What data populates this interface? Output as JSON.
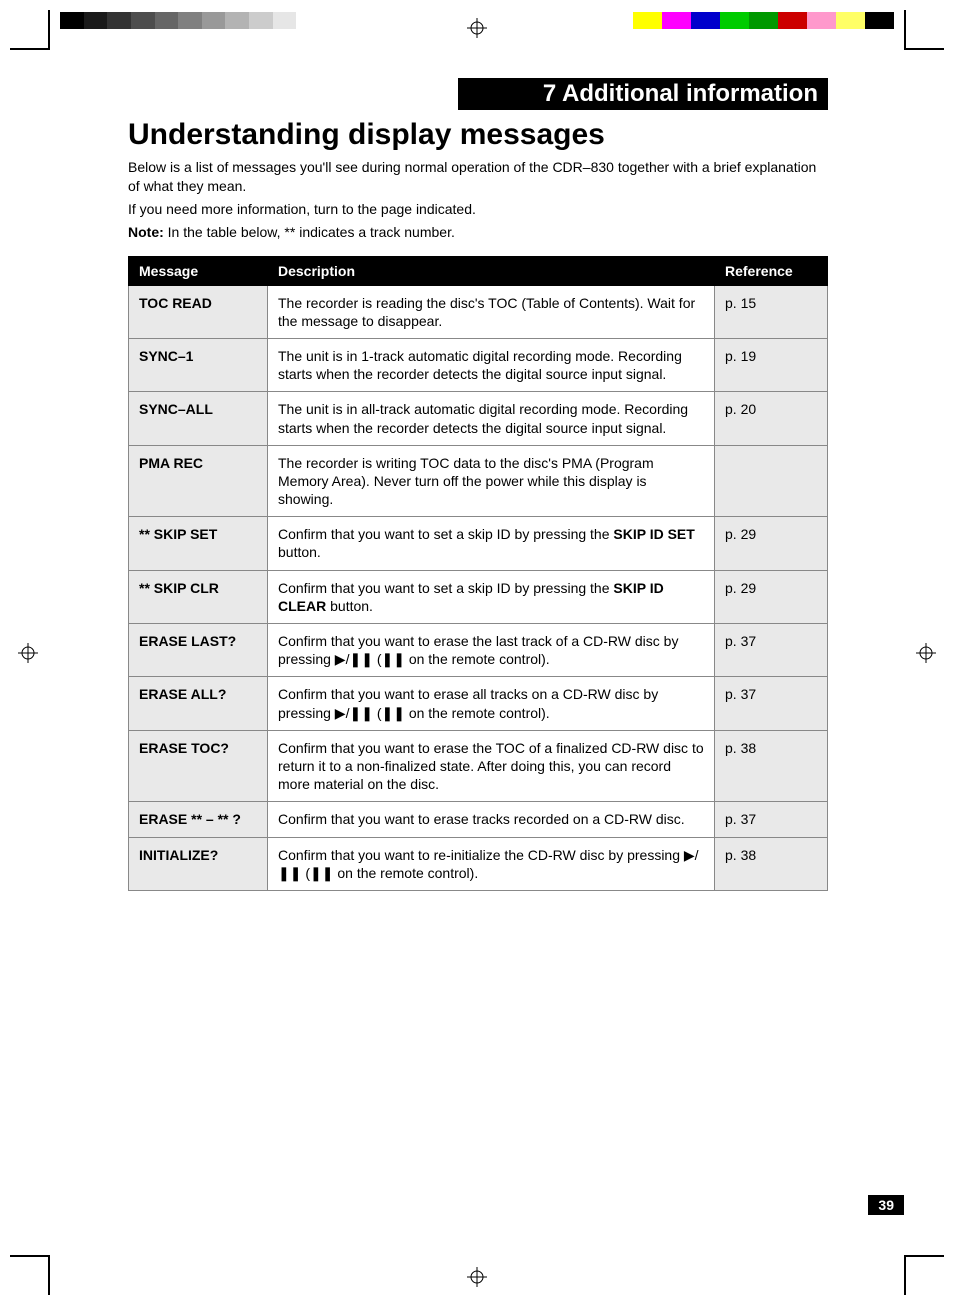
{
  "section_banner": "7 Additional information",
  "page_title": "Understanding display messages",
  "intro_line1": "Below is a list of messages you'll see during normal operation of the CDR–830 together with a brief explanation of what they mean.",
  "intro_line2": "If you need more information, turn to the page indicated.",
  "note_label": "Note:",
  "note_text": " In the table below, ** indicates a track number.",
  "headers": {
    "msg": "Message",
    "desc": "Description",
    "ref": "Reference"
  },
  "rows": [
    {
      "msg": "TOC READ",
      "desc": "The recorder is reading the disc's TOC (Table of Contents). Wait for the message to disappear.",
      "ref": "p. 15"
    },
    {
      "msg": "SYNC–1",
      "desc": "The unit is in 1-track automatic digital recording mode. Recording starts when the recorder detects the digital source input signal.",
      "ref": "p. 19"
    },
    {
      "msg": "SYNC–ALL",
      "desc": "The unit is in all-track automatic digital recording mode. Recording starts when the recorder detects the digital source input signal.",
      "ref": "p. 20"
    },
    {
      "msg": "PMA REC",
      "desc": "The recorder is writing TOC data to the disc's PMA (Program Memory Area). Never turn off the power while this display is showing.",
      "ref": ""
    },
    {
      "msg": "** SKIP SET",
      "desc_pre": "Confirm that you want to set a skip ID by pressing the ",
      "desc_bold": "SKIP ID SET",
      "desc_post": " button.",
      "ref": "p. 29"
    },
    {
      "msg": "** SKIP CLR",
      "desc_pre": "Confirm that you want to set a skip ID by pressing the ",
      "desc_bold": "SKIP ID CLEAR",
      "desc_post": " button.",
      "ref": "p. 29"
    },
    {
      "msg": "ERASE LAST?",
      "desc": "Confirm that you want to erase the last track of a CD-RW disc by pressing ▶/❚❚ (❚❚ on the remote control).",
      "ref": "p. 37"
    },
    {
      "msg": "ERASE ALL?",
      "desc": "Confirm that you want to erase all tracks on a CD-RW disc by pressing ▶/❚❚ (❚❚ on the remote control).",
      "ref": "p. 37"
    },
    {
      "msg": "ERASE TOC?",
      "desc": "Confirm that you want to erase the TOC of a finalized CD-RW disc to return it to a non-finalized state. After doing this, you can record more material on the disc.",
      "ref": "p. 38"
    },
    {
      "msg": "ERASE ** – ** ?",
      "desc": "Confirm that you want to erase tracks recorded on a CD-RW disc.",
      "ref": "p. 37"
    },
    {
      "msg": "INITIALIZE?",
      "desc": "Confirm that you want to re-initialize the CD-RW disc by pressing ▶/❚❚ (❚❚ on the remote control).",
      "ref": "p. 38"
    }
  ],
  "page_number": "39",
  "gray_shades": [
    "#000000",
    "#1a1a1a",
    "#333333",
    "#4d4d4d",
    "#666666",
    "#808080",
    "#999999",
    "#b3b3b3",
    "#cccccc",
    "#e6e6e6",
    "#ffffff"
  ],
  "color_swatches": [
    "#ffffff",
    "#ffff00",
    "#ff00ff",
    "#0000cc",
    "#00cc00",
    "#009900",
    "#cc0000",
    "#ff99cc",
    "#ffff66",
    "#000000"
  ]
}
